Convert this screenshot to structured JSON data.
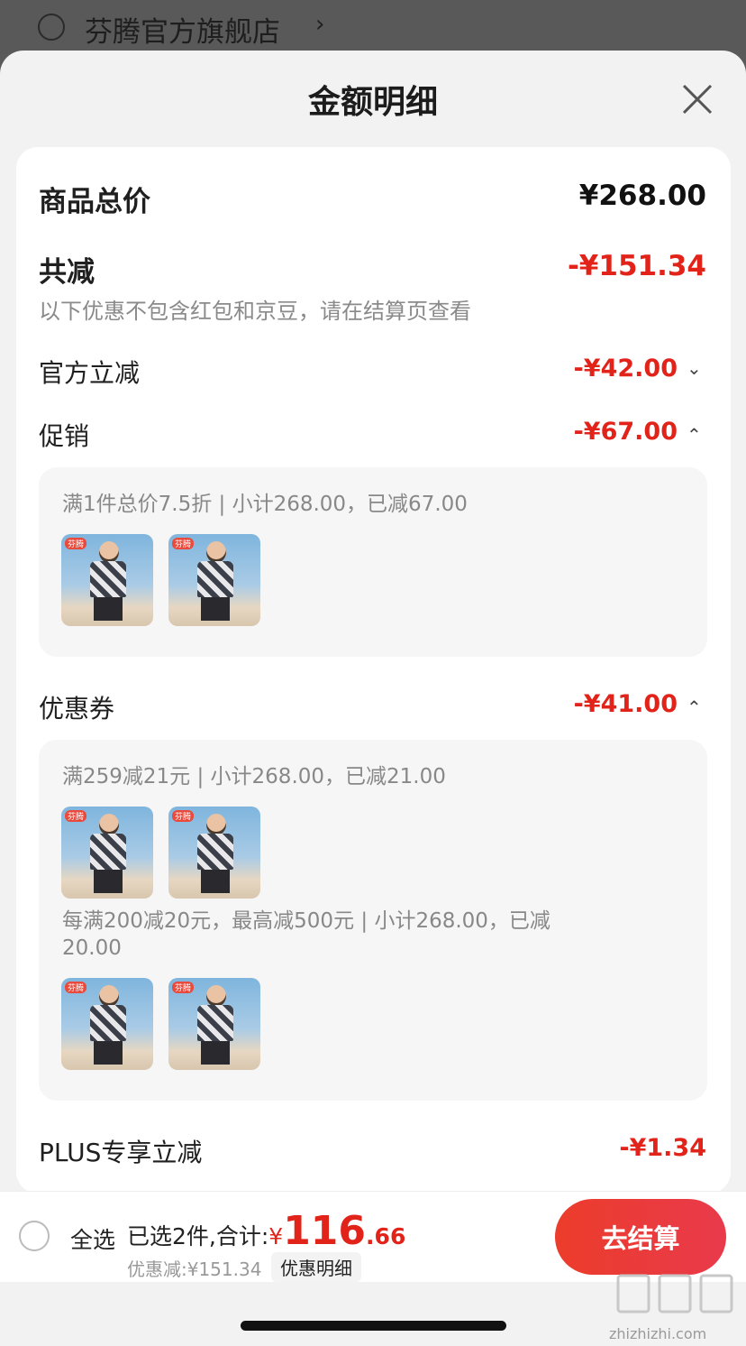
{
  "store": {
    "name": "芬腾官方旗舰店",
    "chevron": "›"
  },
  "sheet": {
    "title": "金额明细"
  },
  "summary": {
    "total_label": "商品总价",
    "total_value": "¥268.00",
    "reduction_label": "共减",
    "reduction_value": "-¥151.34",
    "note": "以下优惠不包含红包和京豆，请在结算页查看"
  },
  "rows": {
    "official": {
      "label": "官方立减",
      "value": "-¥42.00",
      "chevron": "⌄"
    },
    "promo": {
      "label": "促销",
      "value": "-¥67.00",
      "chevron": "⌃"
    },
    "coupon": {
      "label": "优惠券",
      "value": "-¥41.00",
      "chevron": "⌃"
    },
    "plus": {
      "label": "PLUS专享立减",
      "value": "-¥1.34"
    }
  },
  "promo_details": [
    {
      "text": "满1件总价7.5折 | 小计268.00，已减67.00"
    }
  ],
  "coupon_details": [
    {
      "text": "满259减21元 | 小计268.00，已减21.00"
    },
    {
      "text_line1": "每满200减20元，最高减500元 | 小计268.00，已减",
      "text_line2": "20.00"
    }
  ],
  "thumb_logo": "芬腾",
  "bottom": {
    "select_all": "全选",
    "selected_text": "已选2件,合计:",
    "price_symbol": "¥",
    "price_int": "116",
    "price_dec": ".66",
    "discount_text": "优惠减:¥151.34",
    "discount_detail": "优惠明细",
    "checkout": "去结算"
  },
  "watermark": {
    "site": "zhizhizhi.com"
  },
  "icons": {
    "close": "close-icon",
    "radio": "radio-circle"
  }
}
